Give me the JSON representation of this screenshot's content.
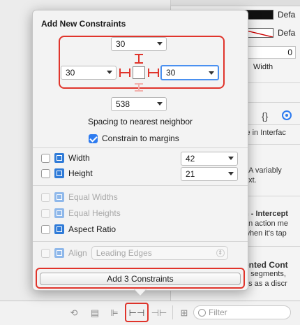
{
  "inspector_bg": {
    "row1_value": "Defa",
    "row2_value": "Defa",
    "number_value": "0",
    "width_label": "Width",
    "braces_glyph": "{}",
    "line_interface": "le in Interfac",
    "line_variably_a": "- A variably",
    "line_variably_b": "ext.",
    "line_intercept_a": "n - Intercept",
    "line_intercept_b": "an action me",
    "line_intercept_c": "when it's tap",
    "line_segmented_a": "ented Cont",
    "line_segmented_b": "e segments,",
    "line_segmented_c": "ns as a discr"
  },
  "popover": {
    "title": "Add New Constraints",
    "top_value": "30",
    "left_value": "30",
    "right_value": "30",
    "bottom_value": "538",
    "spacing_label": "Spacing to nearest neighbor",
    "constrain_margins_label": "Constrain to margins",
    "constrain_margins_checked": true,
    "width_label": "Width",
    "width_value": "42",
    "height_label": "Height",
    "height_value": "21",
    "equal_widths_label": "Equal Widths",
    "equal_heights_label": "Equal Heights",
    "aspect_ratio_label": "Aspect Ratio",
    "align_label": "Align",
    "align_value": "Leading Edges",
    "add_button_label": "Add 3 Constraints"
  },
  "bottom_bar": {
    "filter_placeholder": "Filter",
    "icons": [
      "resolve-icon",
      "stack-icon",
      "align-icon",
      "pin-icon",
      "resizing-icon",
      "grid-icon",
      "filter-icon"
    ]
  },
  "colors": {
    "accent": "#2d7bf0",
    "highlight_red": "#e0342b",
    "ib_icon_blue": "#2f7bd8"
  }
}
